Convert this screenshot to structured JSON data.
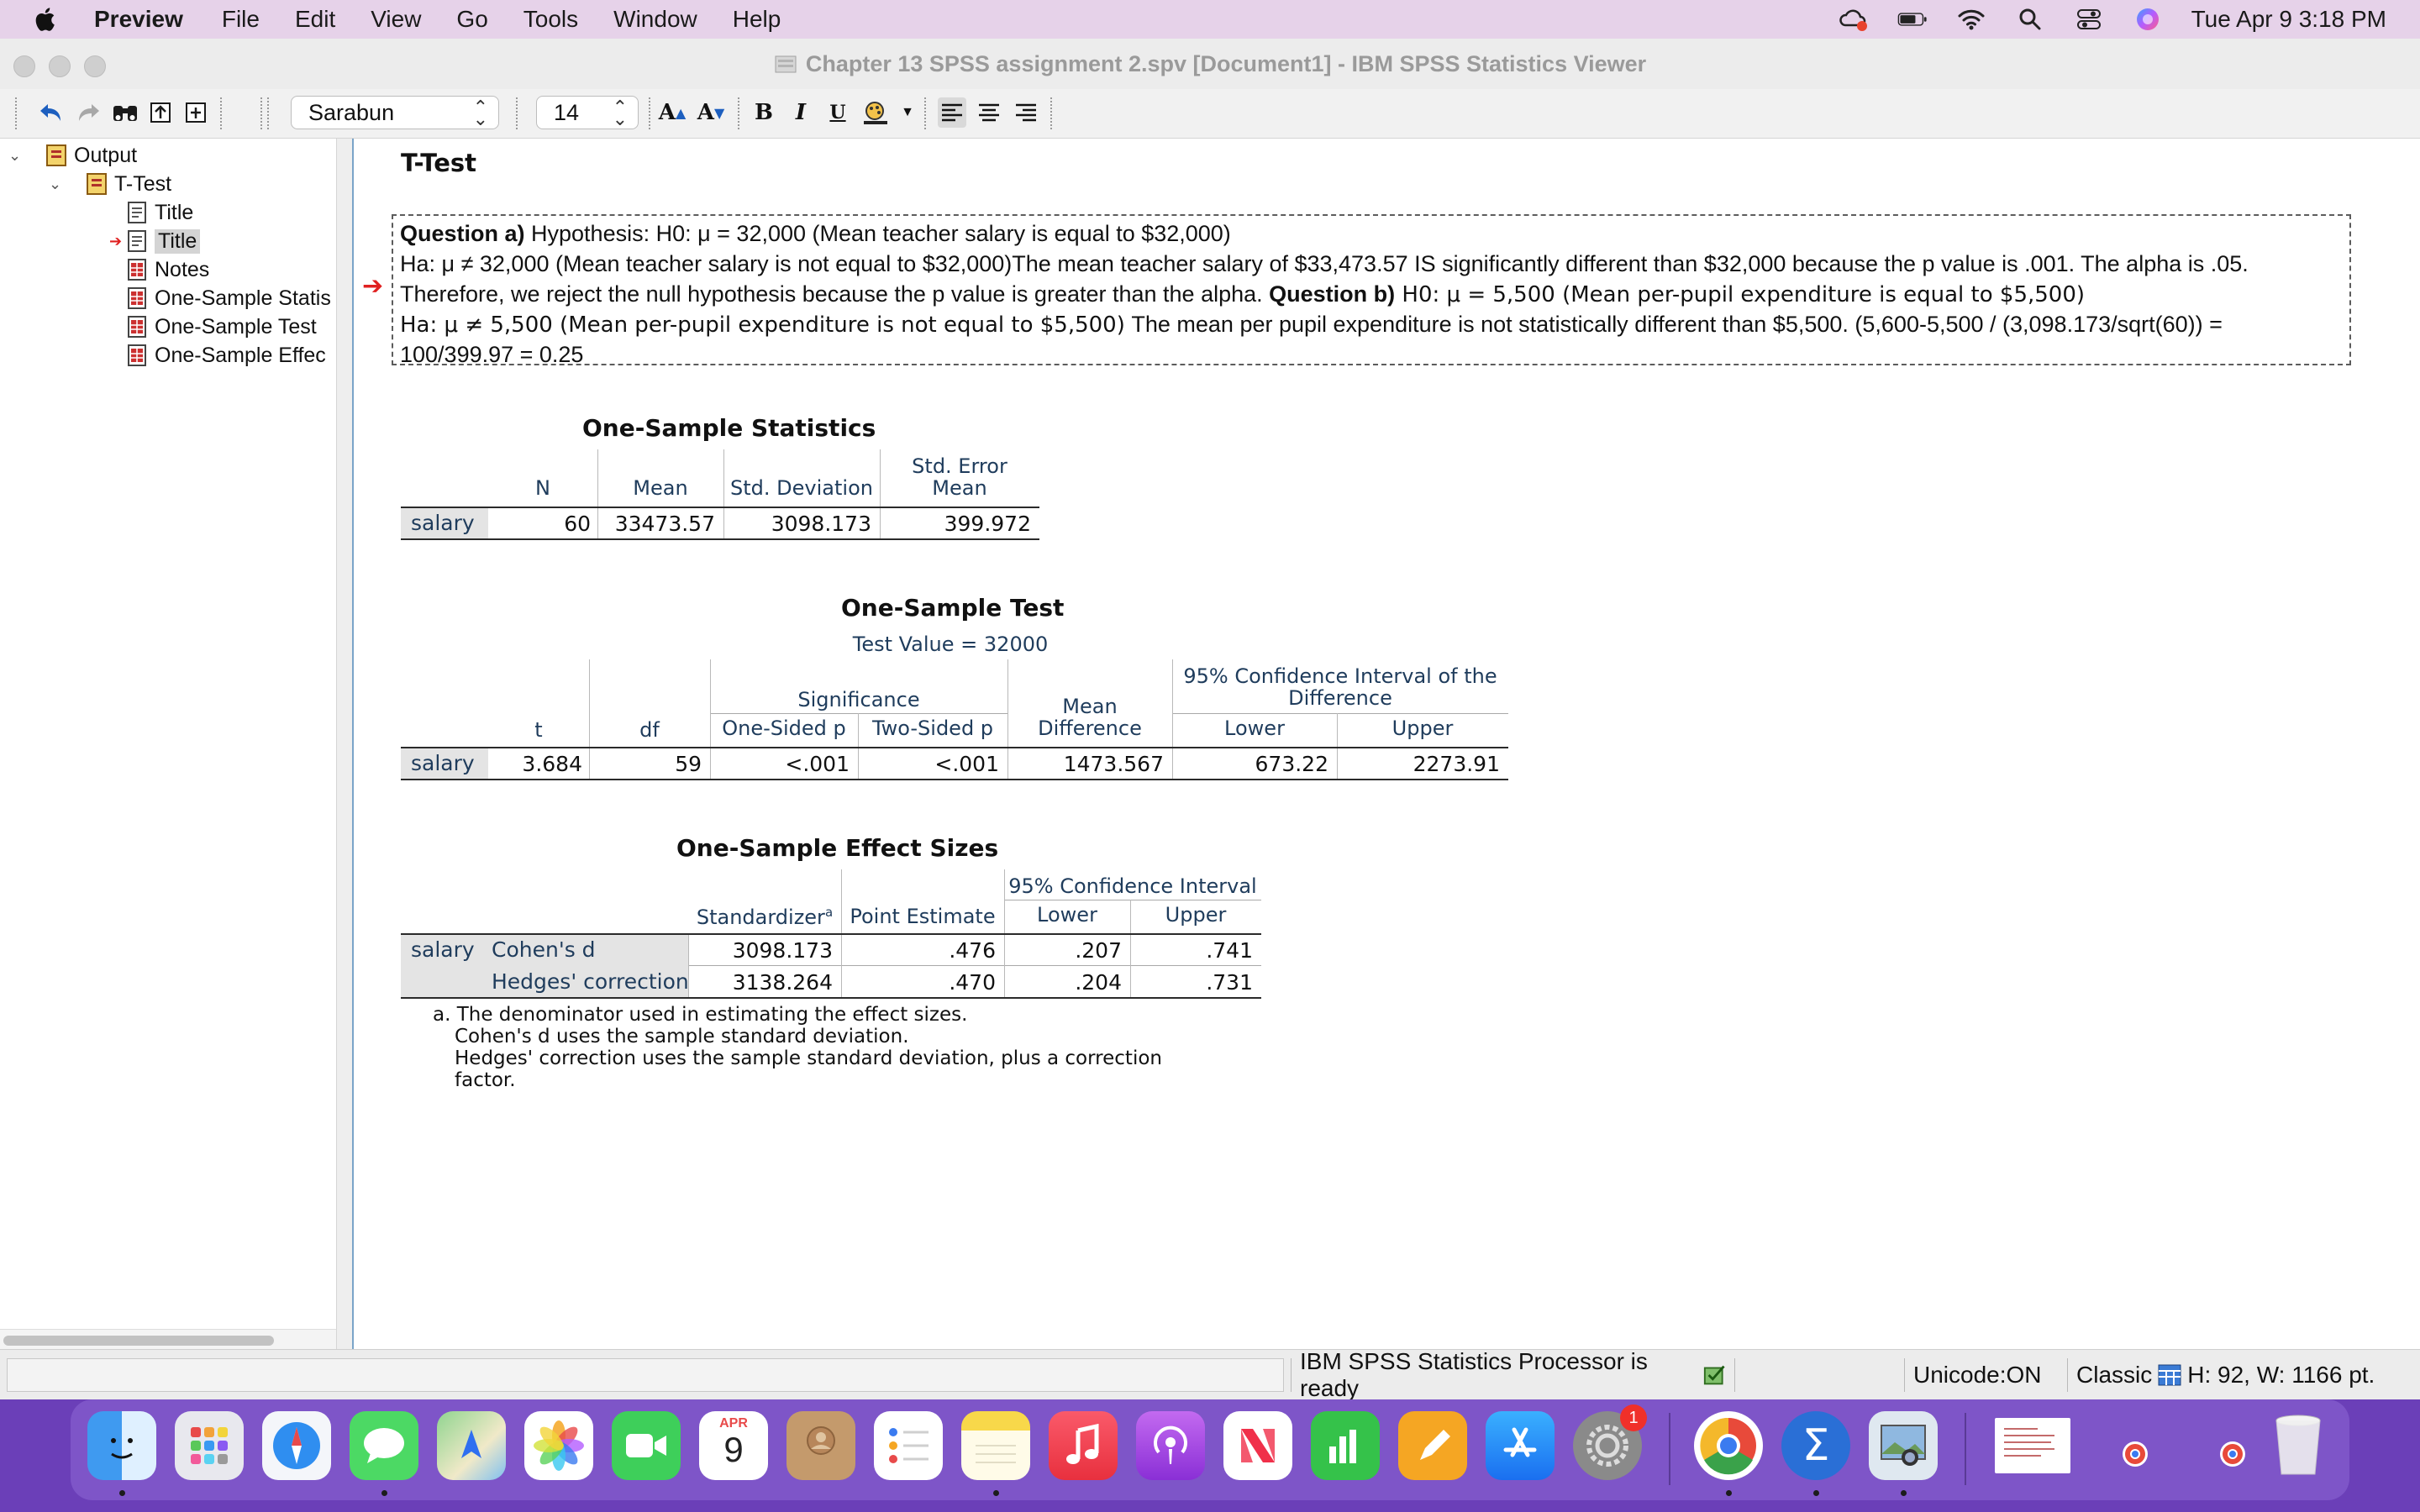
{
  "menubar": {
    "app": "Preview",
    "items": [
      "File",
      "Edit",
      "View",
      "Go",
      "Tools",
      "Window",
      "Help"
    ],
    "clock": "Tue Apr 9  3:18 PM"
  },
  "window": {
    "title": "Chapter 13 SPSS assignment 2.spv [Document1] - IBM SPSS Statistics Viewer"
  },
  "toolbar": {
    "font_name": "Sarabun",
    "font_size": "14"
  },
  "outline": {
    "root": "Output",
    "group": "T-Test",
    "items": [
      "Title",
      "Title",
      "Notes",
      "One-Sample Statis",
      "One-Sample Test",
      "One-Sample Effec"
    ]
  },
  "content": {
    "heading": "T-Test",
    "textbox": {
      "line1_b": "Question a)",
      "line1": " Hypothesis: H0: μ = 32,000 (Mean teacher salary is equal to $32,000)",
      "line2": "Ha: μ ≠ 32,000 (Mean teacher salary is not equal to $32,000)The mean teacher salary of $33,473.57 IS significantly different than $32,000 because the p value is .001. The alpha is .05.",
      "line3": "Therefore, we reject the null hypothesis because the p value is greater than the alpha. ",
      "line3_b": "Question b)",
      "line3_tail": " H0: μ = 5,500 (Mean per-pupil expenditure is equal to $5,500)",
      "line4_a": "Ha: μ ≠ 5,500 (Mean per-pupil expenditure is not equal to $5,500)",
      "line4_b": " The mean per pupil expenditure is not statistically different than $5,500. (5,600-5,500 / (3,098.173/sqrt(60)) =",
      "line5": "100/399.97 = 0.25"
    },
    "stats": {
      "title": "One-Sample Statistics",
      "headers": [
        "N",
        "Mean",
        "Std. Deviation",
        "Std. Error",
        "Mean"
      ],
      "row_label": "salary",
      "values": [
        "60",
        "33473.57",
        "3098.173",
        "399.972"
      ]
    },
    "test": {
      "title": "One-Sample Test",
      "subtitle": "Test Value = 32000",
      "significance": "Significance",
      "ci_header1": "95% Confidence Interval of the",
      "ci_header2": "Difference",
      "md1": "Mean",
      "md2": "Difference",
      "headers": [
        "t",
        "df",
        "One-Sided p",
        "Two-Sided p",
        "Lower",
        "Upper"
      ],
      "row_label": "salary",
      "values": [
        "3.684",
        "59",
        "<.001",
        "<.001",
        "1473.567",
        "673.22",
        "2273.91"
      ]
    },
    "effect": {
      "title": "One-Sample Effect Sizes",
      "ci_header": "95% Confidence Interval",
      "headers": [
        "Standardizer",
        "a",
        "Point Estimate",
        "Lower",
        "Upper"
      ],
      "row_label": "salary",
      "rows": [
        {
          "name": "Cohen's d",
          "values": [
            "3098.173",
            ".476",
            ".207",
            ".741"
          ]
        },
        {
          "name": "Hedges' correction",
          "values": [
            "3138.264",
            ".470",
            ".204",
            ".731"
          ]
        }
      ],
      "footnote": [
        "a. The denominator used in estimating the effect sizes.",
        "Cohen's d uses the sample standard deviation.",
        "Hedges' correction uses the sample standard deviation, plus a correction",
        "factor."
      ]
    }
  },
  "statusbar": {
    "processor": "IBM SPSS Statistics Processor is ready",
    "unicode": "Unicode:ON",
    "mode": "Classic",
    "dims": "H: 92, W: 1166 pt."
  },
  "dock": {
    "calendar_month": "APR",
    "calendar_day": "9",
    "badge": "1",
    "icons": [
      "finder-icon",
      "launchpad-icon",
      "safari-icon",
      "messages-icon",
      "maps-icon",
      "photos-icon",
      "facetime-icon",
      "calendar-icon",
      "contacts-icon",
      "reminders-icon",
      "notes-icon",
      "music-icon",
      "podcasts-icon",
      "news-icon",
      "numbers-icon",
      "pages-icon",
      "app-store-icon",
      "system-settings-icon",
      "chrome-icon",
      "spss-icon",
      "preview-icon",
      "document-thumbnail",
      "trash-icon"
    ]
  },
  "colors": {
    "menubar_bg": "#e6d2e9",
    "dock_bg": "#7e55c8",
    "header_text": "#1f3c5c",
    "selection_arrow": "#e02020"
  }
}
